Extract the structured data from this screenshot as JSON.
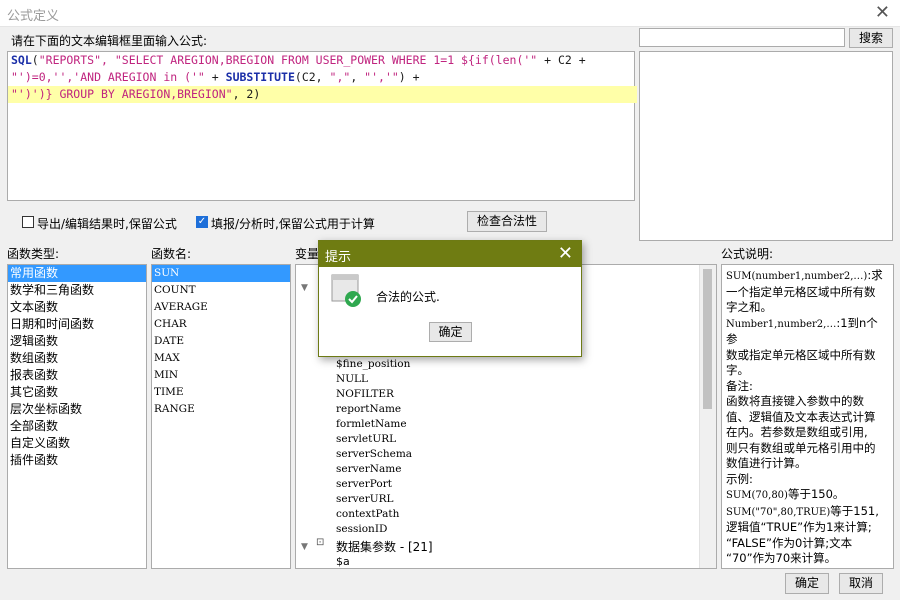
{
  "window": {
    "title": "公式定义"
  },
  "editor": {
    "prompt": "请在下面的文本编辑框里面输入公式:",
    "lines": [
      [
        {
          "cls": "fn",
          "text": "SQL"
        },
        {
          "cls": "tx",
          "text": "("
        },
        {
          "cls": "str",
          "text": "\"REPORTS\", \"SELECT AREGION,BREGION FROM USER_POWER WHERE 1=1 ${if(len('\""
        },
        {
          "cls": "tx",
          "text": " + C2 +"
        }
      ],
      [
        {
          "cls": "str",
          "text": "\"')=0,'','AND AREGION in ('\""
        },
        {
          "cls": "tx",
          "text": " + "
        },
        {
          "cls": "fn",
          "text": "SUBSTITUTE"
        },
        {
          "cls": "tx",
          "text": "(C2, "
        },
        {
          "cls": "str",
          "text": "\",\""
        },
        {
          "cls": "tx",
          "text": ", "
        },
        {
          "cls": "str",
          "text": "\"','\""
        },
        {
          "cls": "tx",
          "text": ") +"
        }
      ],
      [
        {
          "cls": "str",
          "text": "\"')')} GROUP BY AREGION,BREGION\""
        },
        {
          "cls": "tx",
          "text": ", 2)"
        }
      ]
    ]
  },
  "search": {
    "value": "",
    "button": "搜索"
  },
  "options": {
    "keep_formula_export": {
      "label": "导出/编辑结果时,保留公式",
      "checked": false
    },
    "keep_formula_fill": {
      "label": "填报/分析时,保留公式用于计算",
      "checked": true
    },
    "validate_button": "检查合法性"
  },
  "function_types": {
    "header": "函数类型:",
    "items": [
      "常用函数",
      "数学和三角函数",
      "文本函数",
      "日期和时间函数",
      "逻辑函数",
      "数组函数",
      "报表函数",
      "其它函数",
      "层次坐标函数",
      "全部函数",
      "自定义函数",
      "插件函数"
    ],
    "selected": 0
  },
  "function_names": {
    "header": "函数名:",
    "items": [
      "SUN",
      "COUNT",
      "AVERAGE",
      "CHAR",
      "DATE",
      "MAX",
      "MIN",
      "TIME",
      "RANGE"
    ],
    "selected": 0
  },
  "variables": {
    "header": "变量",
    "items": [
      "$fine_position",
      "NULL",
      "NOFILTER",
      "reportName",
      "formletName",
      "servletURL",
      "serverSchema",
      "serverName",
      "serverPort",
      "serverURL",
      "contextPath",
      "sessionID"
    ],
    "group": "数据集参数 - [21]",
    "group_child": "$a"
  },
  "description": {
    "header": "公式说明:",
    "lines": [
      {
        "m": "SUM(number1,number2,…)",
        "t": ":求"
      },
      {
        "m": "",
        "t": "一个指定单元格区域中所有数"
      },
      {
        "m": "",
        "t": "字之和。"
      },
      {
        "m": "Number1,number2,…",
        "t": ":1到n个参"
      },
      {
        "m": "",
        "t": "数或指定单元格区域中所有数"
      },
      {
        "m": "",
        "t": "字。"
      },
      {
        "m": "",
        "t": "备注:"
      },
      {
        "m": "",
        "t": "函数将直接键入参数中的数"
      },
      {
        "m": "",
        "t": "值、逻辑值及文本表达式计算"
      },
      {
        "m": "",
        "t": "在内。若参数是数组或引用,"
      },
      {
        "m": "",
        "t": "则只有数组或单元格引用中的"
      },
      {
        "m": "",
        "t": "数值进行计算。"
      },
      {
        "m": "",
        "t": "示例:"
      },
      {
        "m": "SUM(70,80)",
        "t": "等于150。"
      },
      {
        "m": "SUM(\"70\",80,TRUE)",
        "t": "等于151,"
      },
      {
        "m": "",
        "t": "逻辑值“TRUE”作为1来计算;"
      },
      {
        "m": "",
        "t": "“FALSE”作为0计算;文本"
      },
      {
        "m": "",
        "t": "“70”作为70来计算。"
      }
    ]
  },
  "footer": {
    "ok": "确定",
    "cancel": "取消"
  },
  "dialog": {
    "title": "提示",
    "message": "合法的公式.",
    "ok": "确定"
  }
}
